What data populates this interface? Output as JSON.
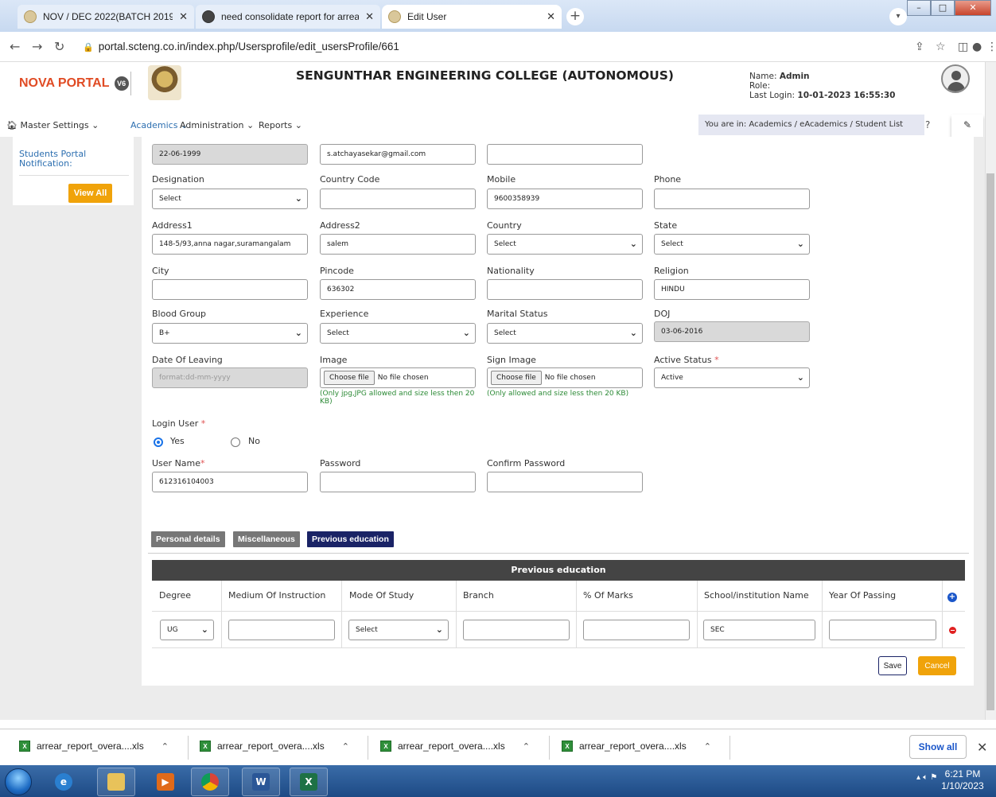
{
  "browser": {
    "tabs": [
      {
        "title": "NOV / DEC 2022(BATCH 2019 TO"
      },
      {
        "title": "need consolidate report for arrea"
      },
      {
        "title": "Edit User"
      }
    ],
    "url": "portal.scteng.co.in/index.php/Usersprofile/edit_usersProfile/661"
  },
  "header": {
    "logo": "NOVA PORTAL",
    "logo_badge": "V6",
    "college": "SENGUNTHAR ENGINEERING COLLEGE (AUTONOMOUS)",
    "name_label": "Name:",
    "name_value": "Admin",
    "role_label": "Role:",
    "last_login_label": "Last Login:",
    "last_login_value": "10-01-2023 16:55:30"
  },
  "menu": {
    "master": "Master Settings",
    "academics": "Academics",
    "administration": "Administration",
    "reports": "Reports",
    "breadcrumb": "You are in:  Academics /  eAcademics / Student List"
  },
  "sidebar": {
    "title": "Students Portal Notification:",
    "view_all": "View All"
  },
  "form": {
    "row0": {
      "dob": "22-06-1999",
      "email": "s.atchayasekar@gmail.com",
      "extra": ""
    },
    "designation": {
      "label": "Designation",
      "value": "Select"
    },
    "country_code": {
      "label": "Country Code",
      "value": ""
    },
    "mobile": {
      "label": "Mobile",
      "value": "9600358939"
    },
    "phone": {
      "label": "Phone",
      "value": ""
    },
    "address1": {
      "label": "Address1",
      "value": "148-5/93,anna nagar,suramangalam"
    },
    "address2": {
      "label": "Address2",
      "value": "salem"
    },
    "country": {
      "label": "Country",
      "value": "Select"
    },
    "state": {
      "label": "State",
      "value": "Select"
    },
    "city": {
      "label": "City",
      "value": ""
    },
    "pincode": {
      "label": "Pincode",
      "value": "636302"
    },
    "nationality": {
      "label": "Nationality",
      "value": ""
    },
    "religion": {
      "label": "Religion",
      "value": "HINDU"
    },
    "blood_group": {
      "label": "Blood Group",
      "value": "B+"
    },
    "experience": {
      "label": "Experience",
      "value": "Select"
    },
    "marital_status": {
      "label": "Marital Status",
      "value": "Select"
    },
    "doj": {
      "label": "DOJ",
      "value": "03-06-2016"
    },
    "date_of_leaving": {
      "label": "Date Of Leaving",
      "placeholder": "format:dd-mm-yyyy"
    },
    "image": {
      "label": "Image",
      "button": "Choose file",
      "status": "No file chosen",
      "hint": "(Only jpg,JPG allowed and size less then 20 KB)"
    },
    "sign_image": {
      "label": "Sign Image",
      "button": "Choose file",
      "status": "No file chosen",
      "hint": "(Only allowed and size less then 20 KB)"
    },
    "active_status": {
      "label": "Active Status",
      "required": "*",
      "value": "Active"
    },
    "login_user": {
      "label": "Login User",
      "required": "*",
      "yes": "Yes",
      "no": "No"
    },
    "user_name": {
      "label": "User Name",
      "required": "*",
      "value": "612316104003"
    },
    "password": {
      "label": "Password",
      "value": ""
    },
    "confirm_password": {
      "label": "Confirm Password",
      "value": ""
    }
  },
  "tabs": {
    "personal": "Personal details",
    "misc": "Miscellaneous",
    "previous": "Previous education"
  },
  "prev_edu": {
    "title": "Previous education",
    "columns": [
      "Degree",
      "Medium Of Instruction",
      "Mode Of Study",
      "Branch",
      "% Of Marks",
      "School/institution Name",
      "Year Of Passing"
    ],
    "row": {
      "degree": "UG",
      "medium": "",
      "mode": "Select",
      "branch": "",
      "marks": "",
      "school": "SEC",
      "year": ""
    }
  },
  "actions": {
    "save": "Save",
    "cancel": "Cancel"
  },
  "downloads": {
    "items": [
      "arrear_report_overa....xls",
      "arrear_report_overa....xls",
      "arrear_report_overa....xls",
      "arrear_report_overa....xls"
    ],
    "show_all": "Show all"
  },
  "taskbar": {
    "time": "6:21 PM",
    "date": "1/10/2023"
  }
}
